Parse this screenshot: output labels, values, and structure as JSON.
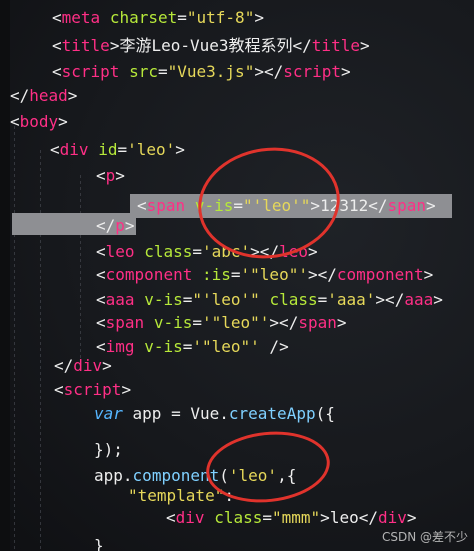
{
  "code_lines": [
    {
      "tokens": [
        "<",
        "meta",
        " ",
        "charset",
        "=",
        "\"utf-8\"",
        ">"
      ]
    },
    {
      "tokens": [
        "<",
        "title",
        ">",
        "李游Leo-Vue3教程系列",
        "</",
        "title",
        ">"
      ]
    },
    {
      "tokens": [
        "<",
        "script",
        " ",
        "src",
        "=",
        "\"Vue3.js\"",
        "></",
        "script",
        ">"
      ]
    },
    {
      "tokens": [
        "</",
        "head",
        ">"
      ]
    },
    {
      "tokens": [
        "<",
        "body",
        ">"
      ]
    },
    {
      "tokens": [
        "<",
        "div",
        " ",
        "id",
        "=",
        "'leo'",
        ">"
      ]
    },
    {
      "tokens": [
        "<",
        "p",
        ">"
      ]
    },
    {
      "tokens": [
        "<",
        "span",
        " ",
        "v-is",
        "=",
        "\"'leo'\"",
        ">",
        "12312",
        "</",
        "span",
        ">"
      ]
    },
    {
      "tokens": [
        "</",
        "p",
        ">"
      ]
    },
    {
      "tokens": [
        "<",
        "leo",
        " ",
        "class",
        "=",
        "'abc'",
        "></",
        "leo",
        ">"
      ]
    },
    {
      "tokens": [
        "<",
        "component",
        " ",
        ":is",
        "=",
        "'\"leo\"'",
        "></",
        "component",
        ">"
      ]
    },
    {
      "tokens": [
        "<",
        "aaa",
        " ",
        "v-is",
        "=",
        "\"'leo'\"",
        " ",
        "class",
        "=",
        "'aaa'",
        "></",
        "aaa",
        ">"
      ]
    },
    {
      "tokens": [
        "<",
        "span",
        " ",
        "v-is",
        "=",
        "'\"leo\"'",
        "></",
        "span",
        ">"
      ]
    },
    {
      "tokens": [
        "<",
        "img",
        " ",
        "v-is",
        "=",
        "'\"leo\"'",
        " />"
      ]
    },
    {
      "tokens": [
        "</",
        "div",
        ">"
      ]
    },
    {
      "tokens": [
        "<",
        "script",
        ">"
      ]
    },
    {
      "tokens": [
        "var",
        " app = ",
        "Vue",
        ".",
        "createApp",
        "({"
      ]
    },
    {
      "tokens": [
        "});"
      ]
    },
    {
      "tokens": [
        "app",
        ".",
        "component",
        "(",
        "'leo'",
        ",{"
      ]
    },
    {
      "tokens": [
        "\"template\"",
        ":"
      ]
    },
    {
      "tokens": [
        "<",
        "div",
        " ",
        "class",
        "=",
        "\"mmm\"",
        ">",
        "leo",
        "</",
        "div",
        ">"
      ]
    },
    {
      "tokens": [
        "}"
      ]
    }
  ],
  "watermark": "CSDN @差不少",
  "colors": {
    "tag": "#ff2f86",
    "attribute": "#b6e83a",
    "string": "#e6d85a",
    "keyword": "#56b6ff",
    "text": "#eeeeee",
    "highlight": "#8e8f93",
    "annotation": "#e0332c"
  }
}
